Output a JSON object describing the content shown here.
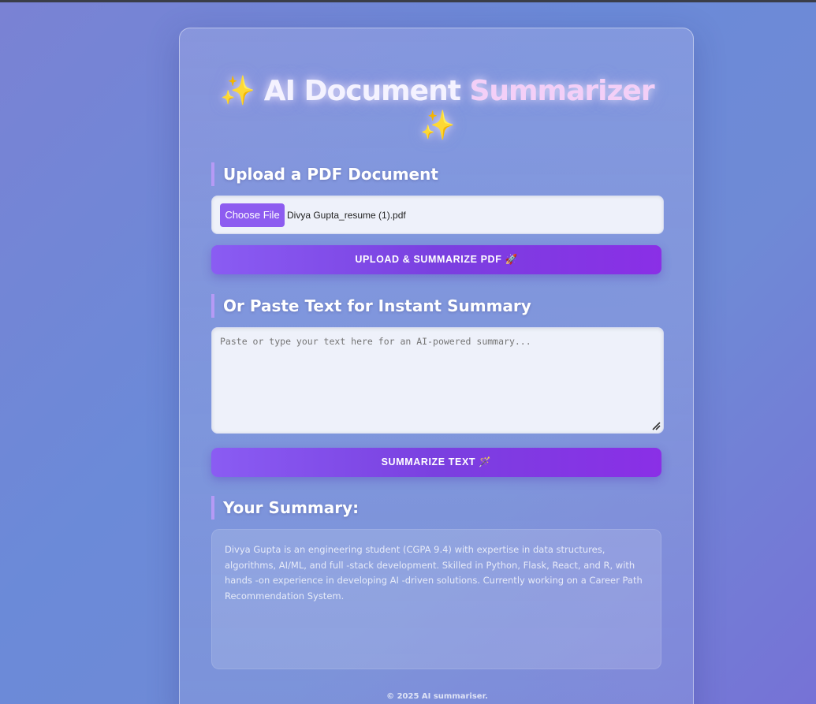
{
  "app": {
    "title_part1": "AI Document",
    "title_part2": "Summarizer",
    "sparkle_glyph": "✨"
  },
  "upload_section": {
    "heading": "Upload a PDF Document",
    "choose_file_label": "Choose File",
    "selected_file": "Divya Gupta_resume (1).pdf",
    "submit_label": "UPLOAD & SUMMARIZE PDF 🚀"
  },
  "paste_section": {
    "heading": "Or Paste Text for Instant Summary",
    "placeholder": "Paste or type your text here for an AI-powered summary...",
    "submit_label": "SUMMARIZE TEXT 🪄"
  },
  "summary_section": {
    "heading": "Your Summary:",
    "text": "Divya Gupta is an engineering student (CGPA 9.4) with expertise in data structures, algorithms, AI/ML, and full -stack development. Skilled in Python, Flask, React, and R, with hands -on experience in developing AI -driven solutions. Currently working on a Career Path Recommendation System."
  },
  "footer": {
    "text": "© 2025 AI summariser."
  },
  "colors": {
    "accent": "#8d5cf0",
    "button_gradient_start": "#8a5cf3",
    "button_gradient_end": "#8a2fe6",
    "section_bar": "#b69af5"
  }
}
